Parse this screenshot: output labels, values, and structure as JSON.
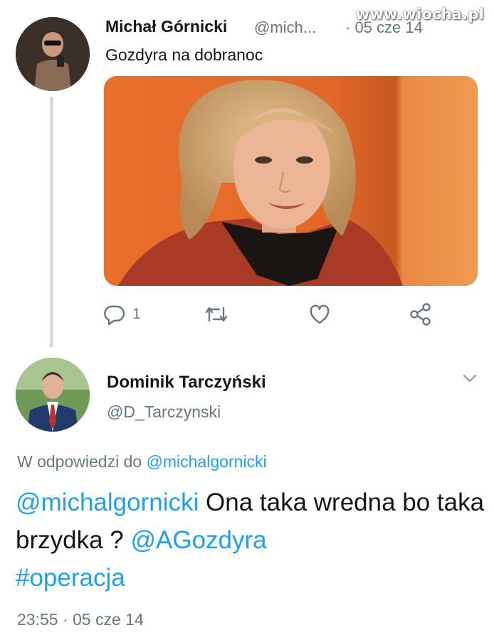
{
  "watermark": "www.wiocha.pl",
  "tweet1": {
    "author_name": "Michał Górnicki",
    "handle": "@mich...",
    "date": "· 05 cze 14",
    "text": "Gozdyra na dobranoc",
    "reply_count": "1",
    "icons": [
      "reply-icon",
      "retweet-icon",
      "like-icon",
      "share-icon"
    ]
  },
  "tweet2": {
    "author_name": "Dominik Tarczyński",
    "handle": "@D_Tarczynski",
    "reply_prefix": "W odpowiedzi do ",
    "reply_handle": "@michalgornicki",
    "body": {
      "mention1": "@michalgornicki",
      "text1": " Ona taka wredna bo taka brzydka ? ",
      "mention2": "@AGozdyra",
      "hashtag": "#operacja"
    },
    "timestamp": "23:55 · 05 cze 14"
  },
  "colors": {
    "link": "#1da1f2",
    "secondary_text": "#657786",
    "thread_line": "#d6dbe0"
  }
}
